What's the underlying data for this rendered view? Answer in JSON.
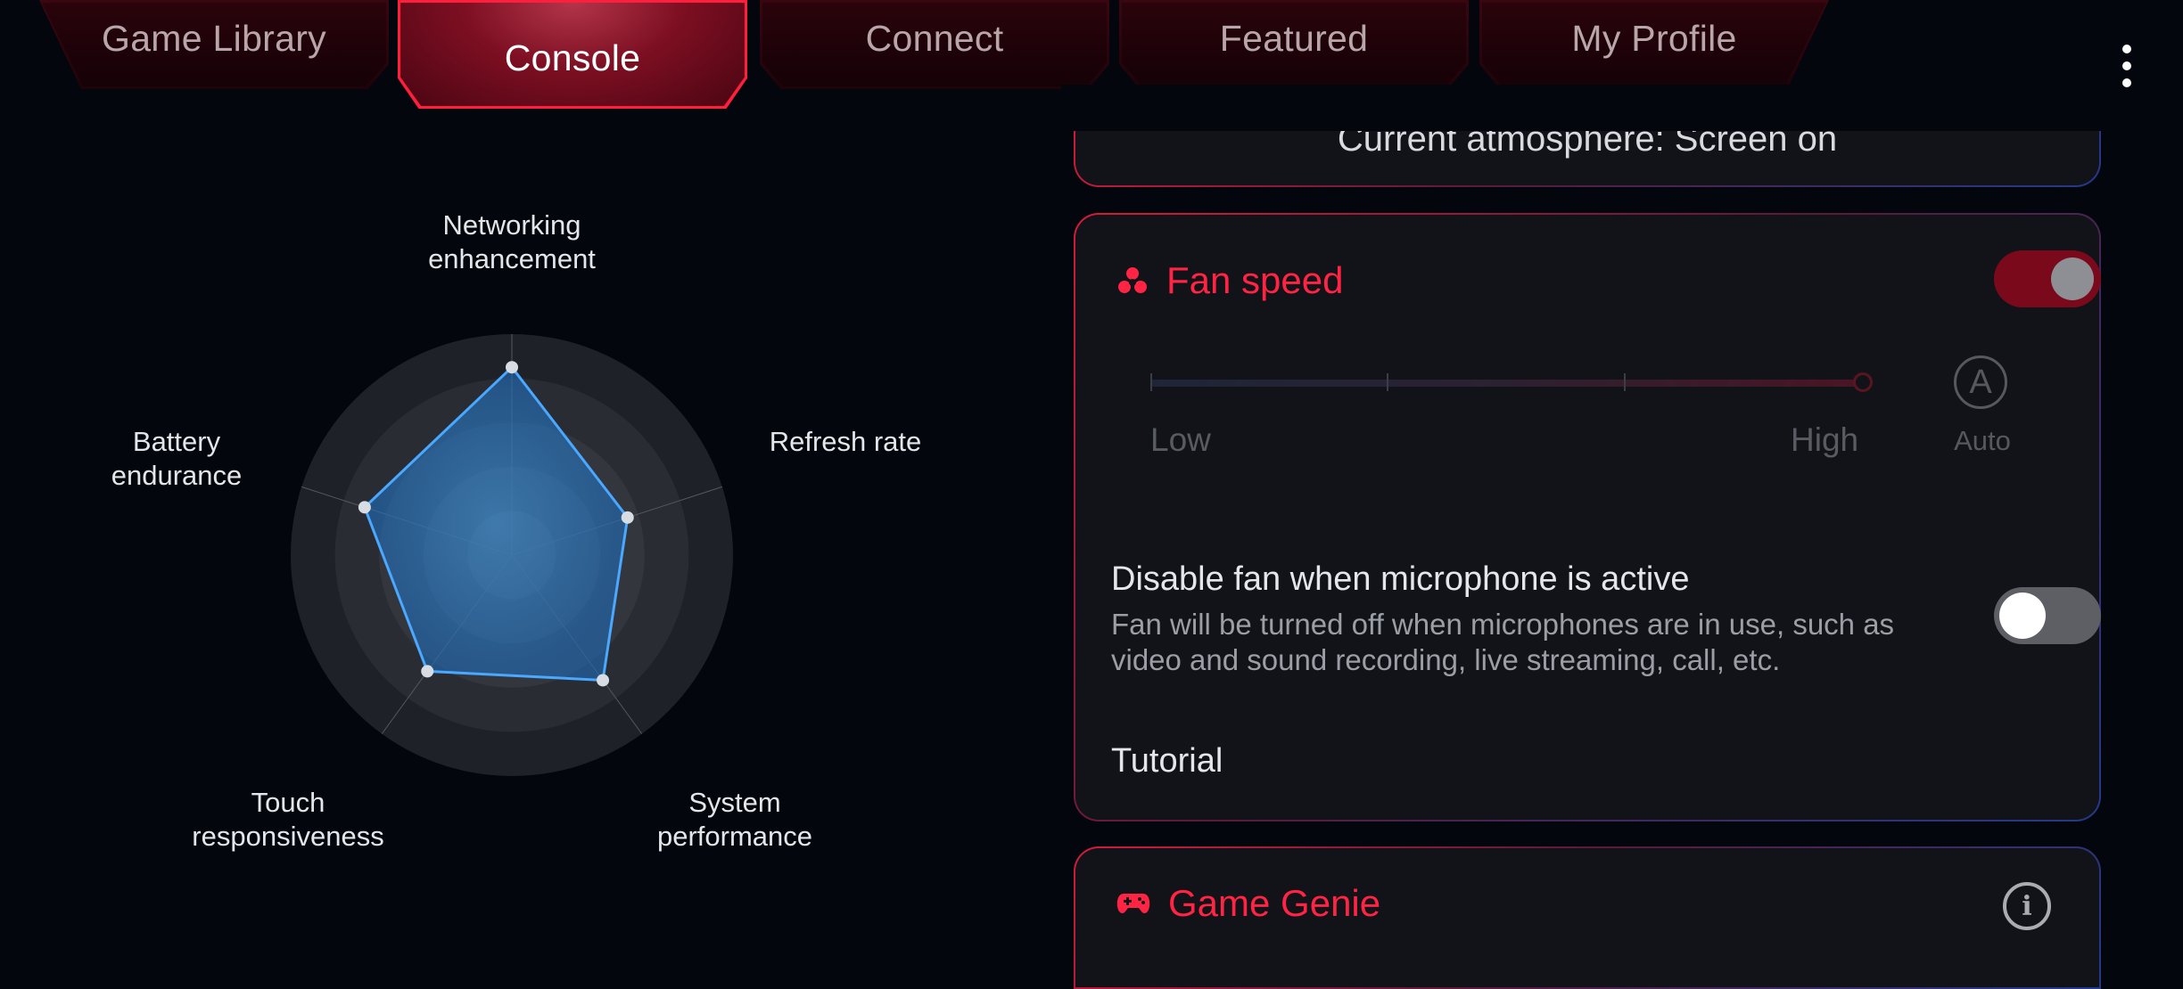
{
  "tabs": [
    {
      "label": "Game Library",
      "active": false
    },
    {
      "label": "Console",
      "active": true
    },
    {
      "label": "Connect",
      "active": false
    },
    {
      "label": "Featured",
      "active": false
    },
    {
      "label": "My Profile",
      "active": false
    }
  ],
  "overflow_icon": "more-vertical-icon",
  "radar": {
    "axes": [
      "Networking\nenhancement",
      "Refresh rate",
      "System\nperformance",
      "Touch\nresponsiveness",
      "Battery\nendurance"
    ],
    "levels": 5,
    "values": [
      0.85,
      0.55,
      0.7,
      0.65,
      0.7
    ],
    "fill_color": "#2f86d6",
    "stroke_color": "#4aa8ff"
  },
  "atmosphere": {
    "text": "Current atmosphere: Screen on"
  },
  "fan": {
    "title": "Fan speed",
    "icon": "fan-icon",
    "enabled": true,
    "slider": {
      "low_label": "Low",
      "high_label": "High",
      "steps": 4,
      "position": 1.0
    },
    "auto": {
      "glyph": "A",
      "label": "Auto"
    },
    "mic_setting": {
      "title": "Disable fan when microphone is active",
      "description": "Fan will be turned off when microphones are in use, such as video and sound recording, live streaming, call, etc.",
      "enabled": false
    },
    "tutorial_label": "Tutorial"
  },
  "genie": {
    "title": "Game Genie",
    "icon": "gamepad-icon",
    "info_glyph": "i"
  },
  "colors": {
    "accent": "#ff2443",
    "background": "#03060d",
    "card": "#111318"
  }
}
